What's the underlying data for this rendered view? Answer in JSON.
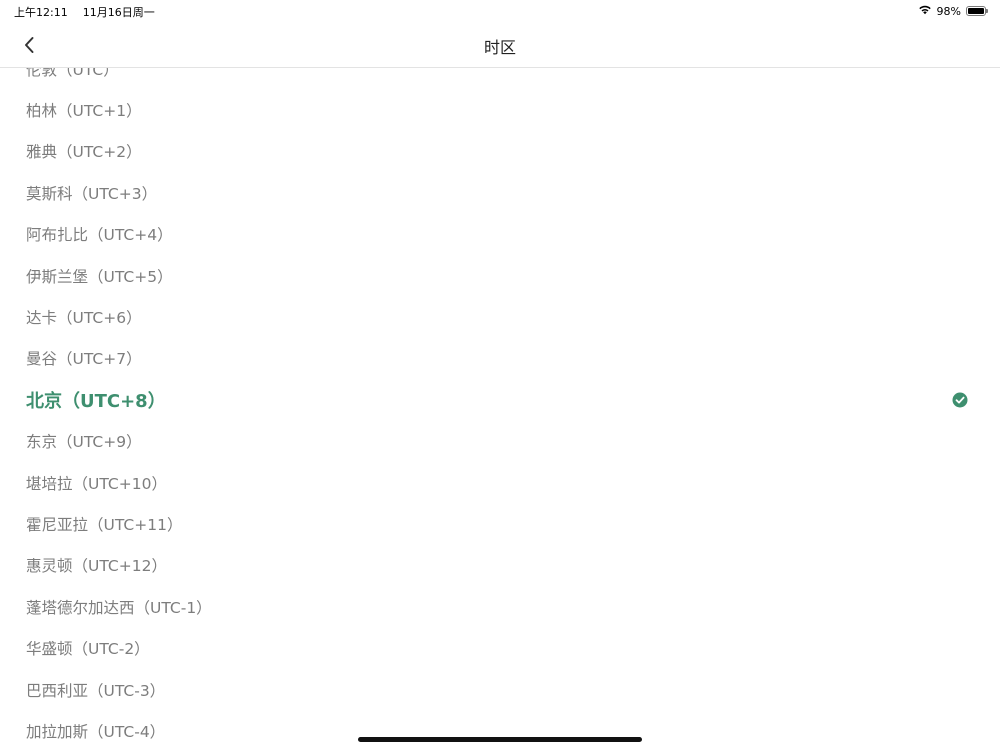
{
  "status_bar": {
    "time": "上午12:11",
    "date": "11月16日周一",
    "battery": "98%",
    "battery_level": 0.98,
    "wifi_icon": "wifi-icon",
    "battery_icon": "battery-icon"
  },
  "nav": {
    "title": "时区",
    "back_icon": "chevron-left-icon"
  },
  "timezones": [
    {
      "label": "伦敦（UTC）",
      "selected": false
    },
    {
      "label": "柏林（UTC+1）",
      "selected": false
    },
    {
      "label": "雅典（UTC+2）",
      "selected": false
    },
    {
      "label": "莫斯科（UTC+3）",
      "selected": false
    },
    {
      "label": "阿布扎比（UTC+4）",
      "selected": false
    },
    {
      "label": "伊斯兰堡（UTC+5）",
      "selected": false
    },
    {
      "label": "达卡（UTC+6）",
      "selected": false
    },
    {
      "label": "曼谷（UTC+7）",
      "selected": false
    },
    {
      "label": "北京（UTC+8）",
      "selected": true
    },
    {
      "label": "东京（UTC+9）",
      "selected": false
    },
    {
      "label": "堪培拉（UTC+10）",
      "selected": false
    },
    {
      "label": "霍尼亚拉（UTC+11）",
      "selected": false
    },
    {
      "label": "惠灵顿（UTC+12）",
      "selected": false
    },
    {
      "label": "蓬塔德尔加达西（UTC-1）",
      "selected": false
    },
    {
      "label": "华盛顿（UTC-2）",
      "selected": false
    },
    {
      "label": "巴西利亚（UTC-3）",
      "selected": false
    },
    {
      "label": "加拉加斯（UTC-4）",
      "selected": false
    }
  ],
  "colors": {
    "selected": "#3e8f6f",
    "item_text": "#7d7d7d",
    "title_text": "#222222"
  }
}
